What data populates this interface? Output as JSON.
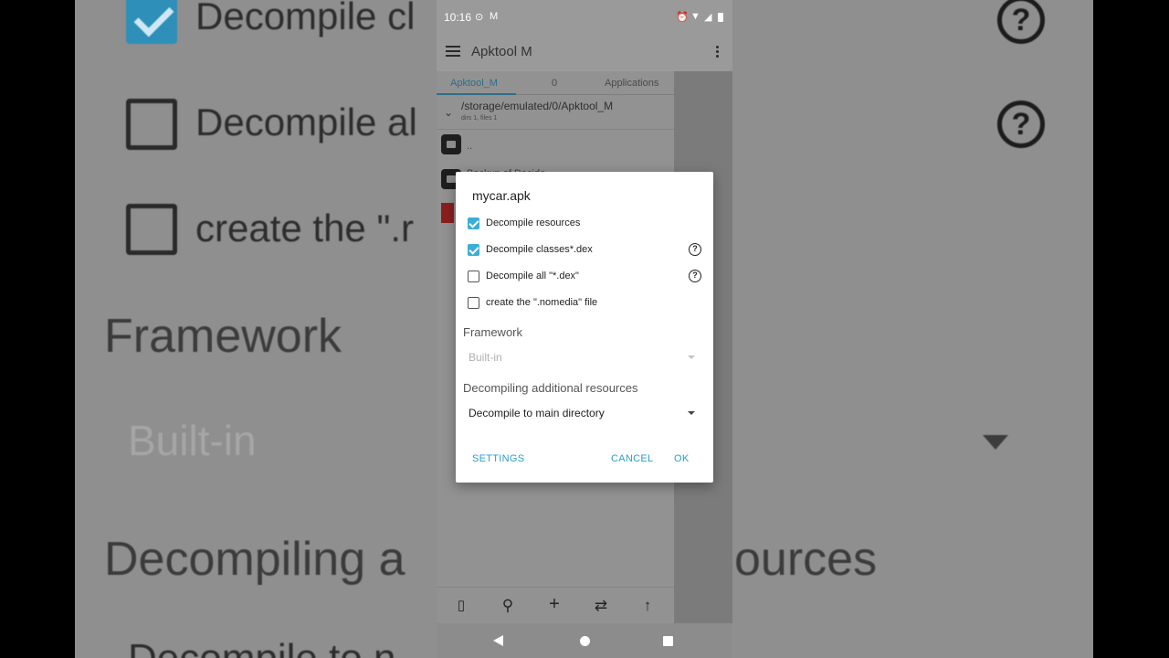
{
  "background": {
    "items": [
      {
        "text": "Decompile cl"
      },
      {
        "text": "Decompile al"
      },
      {
        "text": "create the \".r"
      },
      {
        "text": "Framework"
      },
      {
        "text": "Built-in"
      },
      {
        "text": "Decompiling a"
      },
      {
        "text": "ources"
      },
      {
        "text": "Decompile to n"
      }
    ],
    "help_glyph": "?"
  },
  "statusbar": {
    "time": "10:16",
    "icons": [
      "settings-icon",
      "mail-icon",
      "alarm-icon",
      "wifi-icon",
      "signal-icon",
      "battery-icon"
    ]
  },
  "appbar": {
    "title": "Apktool M"
  },
  "tabs": [
    {
      "label": "Apktool_M"
    },
    {
      "label": "0"
    },
    {
      "label": "Applications"
    }
  ],
  "path": {
    "current": "/storage/emulated/0/Apktool_M",
    "summary": "dirs 1, files 1"
  },
  "file_rows": [
    {
      "label": ".."
    },
    {
      "label": "Backup of Decide"
    }
  ],
  "dialog": {
    "title": "mycar.apk",
    "options": [
      {
        "label": "Decompile resources",
        "checked": true
      },
      {
        "label": "Decompile classes*.dex",
        "checked": true
      },
      {
        "label": "Decompile all \"*.dex\"",
        "checked": false
      },
      {
        "label": "create the \".nomedia\" file",
        "checked": false
      }
    ],
    "help_glyph": "?",
    "framework": {
      "label": "Framework",
      "value": "Built-in"
    },
    "additional": {
      "label": "Decompiling additional resources",
      "value": "Decompile to main directory"
    },
    "buttons": {
      "settings": "SETTINGS",
      "cancel": "CANCEL",
      "ok": "OK"
    }
  },
  "bottom_bar": {
    "add_glyph": "+",
    "swap_glyph": "⇄",
    "up_glyph": "↑"
  },
  "colors": {
    "accent": "#2b9ecb",
    "checkbox": "#3aaed9"
  }
}
